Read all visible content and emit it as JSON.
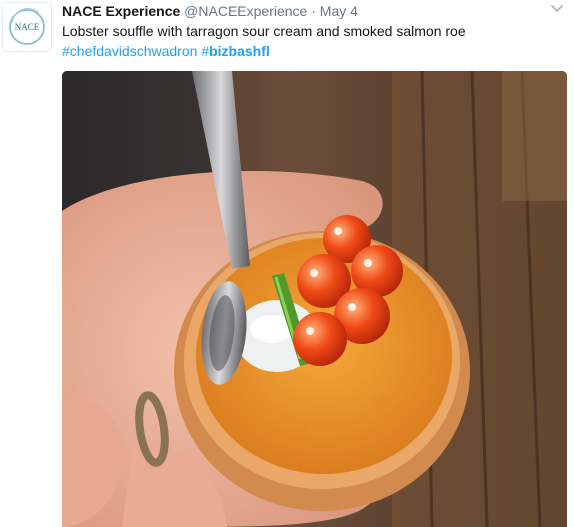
{
  "tweet": {
    "avatar_text": "NACE",
    "display_name": "NACE Experience",
    "screen_name": "@NACEExperience",
    "separator": "·",
    "timestamp": "May 4",
    "text": "Lobster souffle with tarragon sour cream and smoked salmon roe",
    "hashtag_1": "#chefdavidschwadron",
    "hashtag_2_prefix": "#",
    "hashtag_2_bold": "bizbashfl",
    "caret_icon": "chevron-down-icon",
    "colors": {
      "link": "#1da1f2",
      "muted": "#657786",
      "text": "#14171a"
    }
  }
}
